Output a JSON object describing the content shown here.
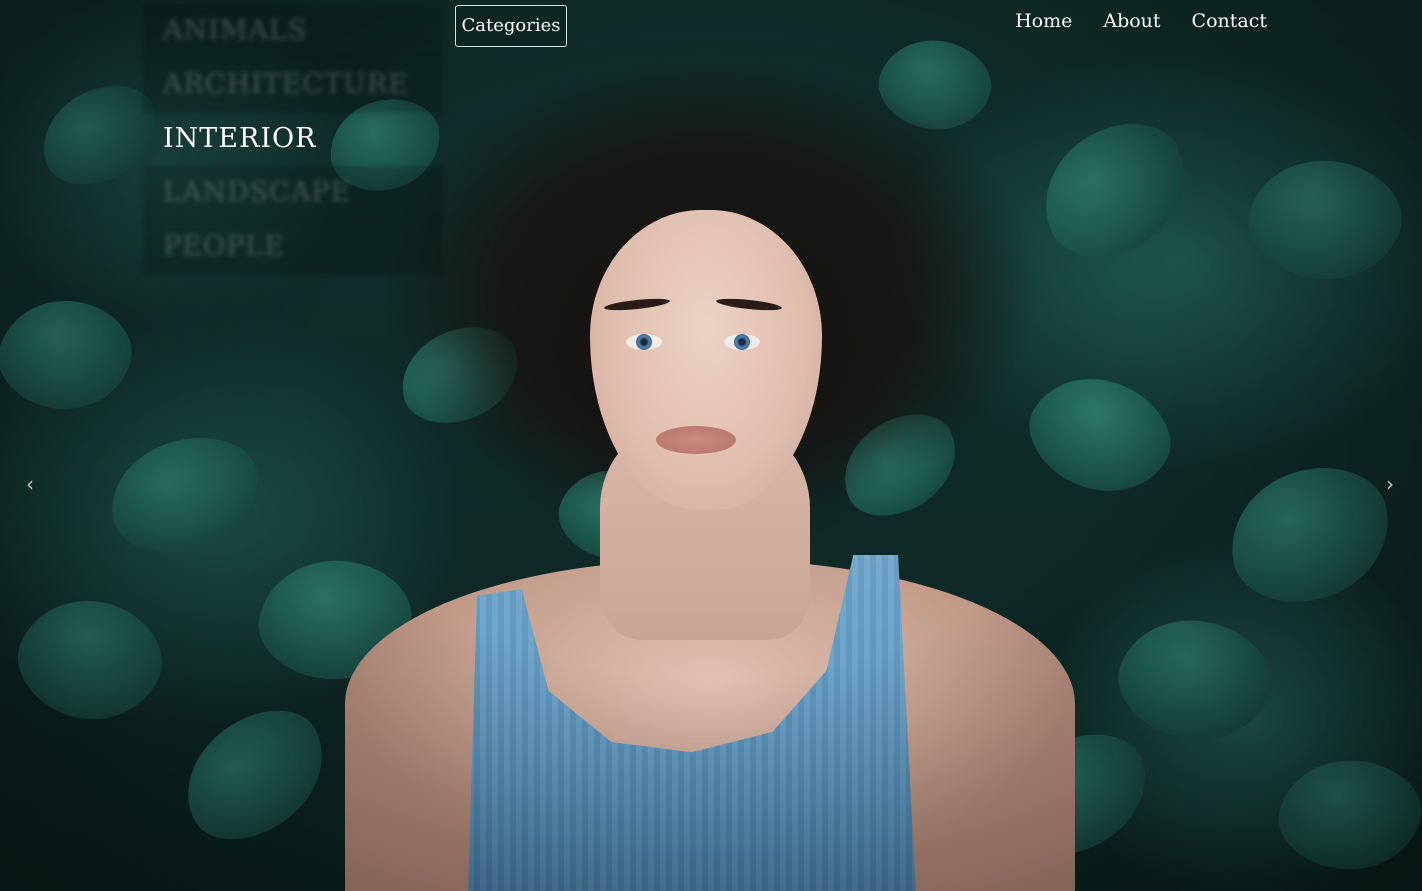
{
  "categories_button": {
    "label": "Categories"
  },
  "category_menu": {
    "items": [
      {
        "label": "Animals",
        "active": false
      },
      {
        "label": "Architecture",
        "active": false
      },
      {
        "label": "Interior",
        "active": true
      },
      {
        "label": "Landscape",
        "active": false
      },
      {
        "label": "People",
        "active": false
      }
    ]
  },
  "nav": {
    "items": [
      {
        "label": "Home"
      },
      {
        "label": "About"
      },
      {
        "label": "Contact"
      }
    ]
  },
  "carousel": {
    "prev_icon": "chevron-left-icon",
    "next_icon": "chevron-right-icon",
    "prev_glyph": "‹",
    "next_glyph": "›"
  },
  "colors": {
    "text": "#ffffff",
    "dress": "#6fa6cc",
    "foliage": "#1d5a4f"
  }
}
